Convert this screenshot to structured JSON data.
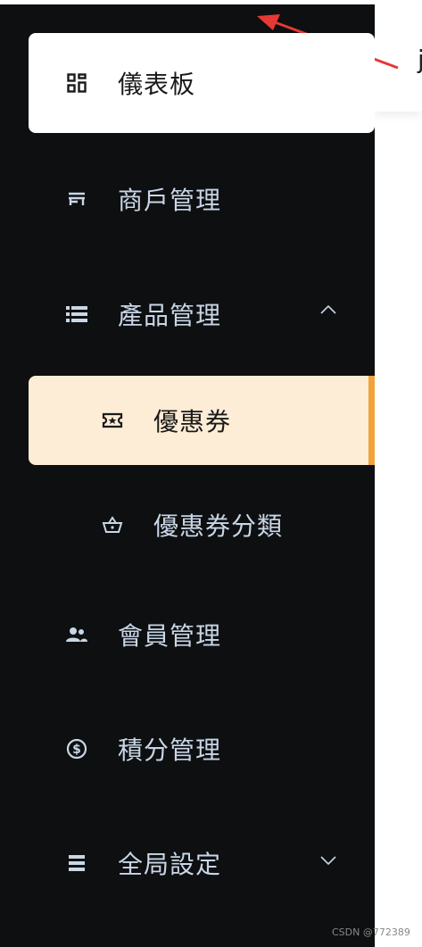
{
  "app": {
    "header_glyph": "j"
  },
  "sidebar": {
    "items": [
      {
        "label": "儀表板",
        "icon": "dashboard-grid-icon",
        "state": "active"
      },
      {
        "label": "商戶管理",
        "icon": "store-icon"
      },
      {
        "label": "產品管理",
        "icon": "list-icon",
        "expanded": true
      },
      {
        "label": "優惠券",
        "icon": "ticket-icon",
        "sub": true,
        "state": "selected"
      },
      {
        "label": "優惠券分類",
        "icon": "basket-icon",
        "sub": true
      },
      {
        "label": "會員管理",
        "icon": "users-icon"
      },
      {
        "label": "積分管理",
        "icon": "dollar-icon"
      },
      {
        "label": "全局設定",
        "icon": "menu-icon",
        "expanded": false
      }
    ]
  },
  "colors": {
    "sidebar_bg": "#0d0f10",
    "text": "#c9d6e6",
    "active_sub_bg": "#fdecd6",
    "accent": "#f2a23a",
    "annotation_arrow": "#e53935"
  },
  "watermark": "CSDN @772389"
}
